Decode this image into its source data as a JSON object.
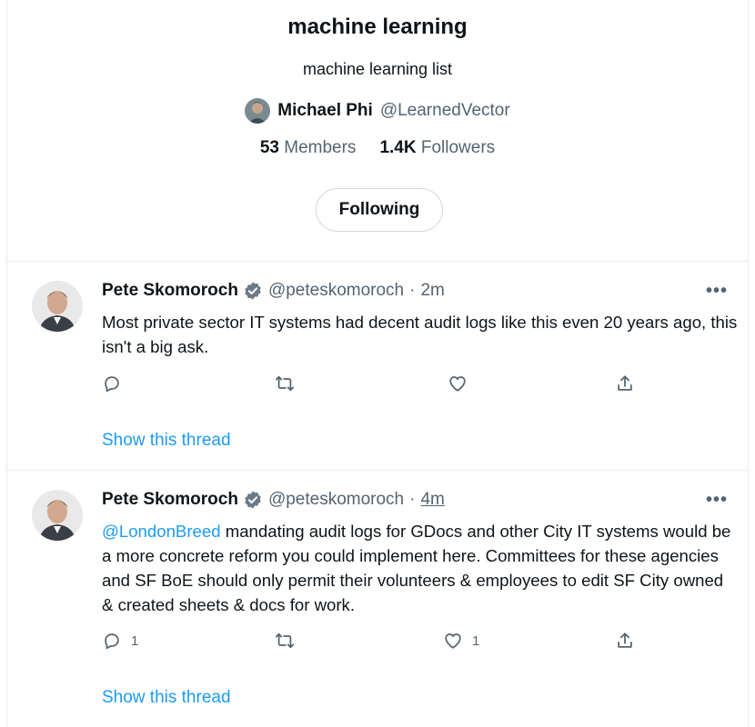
{
  "list": {
    "title": "machine learning",
    "description": "machine learning list",
    "owner_name": "Michael Phi",
    "owner_handle": "@LearnedVector",
    "members_count": "53",
    "members_label": "Members",
    "followers_count": "1.4K",
    "followers_label": "Followers",
    "follow_button_label": "Following"
  },
  "tweets": [
    {
      "author_name": "Pete Skomoroch",
      "author_handle": "@peteskomoroch",
      "separator": "·",
      "time": "2m",
      "more_label": "•••",
      "mention": "",
      "text": "Most private sector IT systems had decent audit logs like this even 20 years ago, this isn't a big ask.",
      "reply_count": "",
      "retweet_count": "",
      "like_count": "",
      "show_thread_label": "Show this thread"
    },
    {
      "author_name": "Pete Skomoroch",
      "author_handle": "@peteskomoroch",
      "separator": "·",
      "time": "4m",
      "more_label": "•••",
      "mention": "@LondonBreed",
      "text": " mandating audit logs for GDocs and other City IT systems would be a more concrete reform you could implement here. Committees for these agencies and SF BoE should only permit their volunteers & employees to edit SF City owned & created sheets & docs for work.",
      "reply_count": "1",
      "retweet_count": "",
      "like_count": "1",
      "show_thread_label": "Show this thread"
    }
  ],
  "icons": {
    "verified": "verified-badge-icon",
    "reply": "reply-icon",
    "retweet": "retweet-icon",
    "like": "like-icon",
    "share": "share-icon"
  },
  "colors": {
    "accent": "#1d9bf0",
    "text_primary": "#0f1419",
    "text_secondary": "#536471",
    "border": "#e6ecf0"
  }
}
